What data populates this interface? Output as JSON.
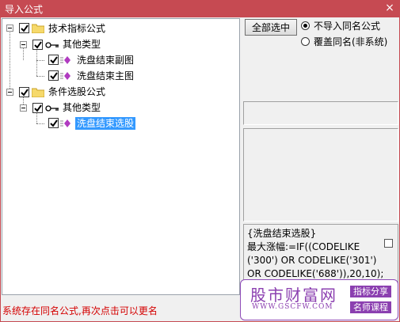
{
  "window": {
    "title": "导入公式",
    "close_glyph": "×"
  },
  "tree": {
    "root1": {
      "label": "技术指标公式"
    },
    "type1": {
      "label": "其他类型"
    },
    "item1": {
      "label": "洗盘结束副图"
    },
    "item2": {
      "label": "洗盘结束主图"
    },
    "root2": {
      "label": "条件选股公式"
    },
    "type2": {
      "label": "其他类型"
    },
    "item3": {
      "label": "洗盘结束选股"
    }
  },
  "buttons": {
    "select_all": "全部选中"
  },
  "options": {
    "skip_same_name": "不导入同名公式",
    "overwrite_same_name": "覆盖同名(非系统)",
    "selected": "skip_same_name"
  },
  "description": {
    "line1": "{洗盘结束选股}",
    "line2": "最大涨幅:=IF((CODELIKE",
    "line3": "('300') OR CODELIKE('301')",
    "line4": "OR CODELIKE('688')),20,10);"
  },
  "status": "系统存在同名公式,再次点击可以更名",
  "watermark": {
    "brand": "股市财富网",
    "url": "WWW.GSCFW.COM",
    "tag1": "指标分享",
    "tag2": "名师课程"
  },
  "colors": {
    "titlebar": "#c64a52",
    "selection": "#3399ff",
    "status_text": "#d40000",
    "watermark": "#8b3fb0"
  }
}
